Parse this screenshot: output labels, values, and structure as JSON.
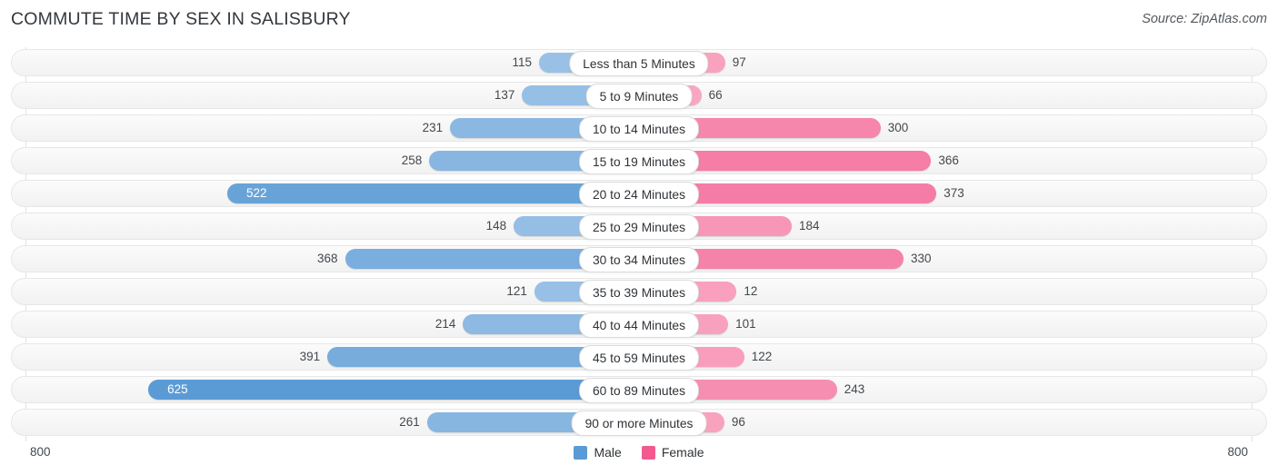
{
  "header": {
    "title": "COMMUTE TIME BY SEX IN SALISBURY",
    "source": "Source: ZipAtlas.com"
  },
  "legend": {
    "male_label": "Male",
    "female_label": "Female",
    "male_color": "#5b9bd5",
    "female_color": "#f2598f"
  },
  "axis": {
    "left_label": "800",
    "right_label": "800",
    "max": 800
  },
  "chart_data": {
    "type": "bar",
    "subtype": "diverging-horizontal-bar",
    "title": "COMMUTE TIME BY SEX IN SALISBURY",
    "xlabel": "",
    "ylabel": "",
    "xlim": [
      800,
      800
    ],
    "grid": true,
    "legend_position": "bottom-center",
    "categories": [
      "Less than 5 Minutes",
      "5 to 9 Minutes",
      "10 to 14 Minutes",
      "15 to 19 Minutes",
      "20 to 24 Minutes",
      "25 to 29 Minutes",
      "30 to 34 Minutes",
      "35 to 39 Minutes",
      "40 to 44 Minutes",
      "45 to 59 Minutes",
      "60 to 89 Minutes",
      "90 or more Minutes"
    ],
    "series": [
      {
        "name": "Male",
        "color": "#5b9bd5",
        "direction": "left",
        "values": [
          115,
          137,
          231,
          258,
          522,
          148,
          368,
          121,
          214,
          391,
          625,
          261
        ]
      },
      {
        "name": "Female",
        "color": "#f2598f",
        "direction": "right",
        "values": [
          97,
          66,
          300,
          366,
          373,
          184,
          330,
          12,
          101,
          122,
          243,
          96
        ]
      }
    ]
  },
  "rows": [
    {
      "category": "Less than 5 Minutes",
      "male": "115",
      "female": "97",
      "male_bar": 115,
      "female_bar": 97,
      "male_inside": false,
      "female_inside": false
    },
    {
      "category": "5 to 9 Minutes",
      "male": "137",
      "female": "66",
      "male_bar": 137,
      "female_bar": 66,
      "male_inside": false,
      "female_inside": false
    },
    {
      "category": "10 to 14 Minutes",
      "male": "231",
      "female": "300",
      "male_bar": 231,
      "female_bar": 300,
      "male_inside": false,
      "female_inside": false
    },
    {
      "category": "15 to 19 Minutes",
      "male": "258",
      "female": "366",
      "male_bar": 258,
      "female_bar": 366,
      "male_inside": false,
      "female_inside": false
    },
    {
      "category": "20 to 24 Minutes",
      "male": "522",
      "female": "373",
      "male_bar": 522,
      "female_bar": 373,
      "male_inside": true,
      "female_inside": false
    },
    {
      "category": "25 to 29 Minutes",
      "male": "148",
      "female": "184",
      "male_bar": 148,
      "female_bar": 184,
      "male_inside": false,
      "female_inside": false
    },
    {
      "category": "30 to 34 Minutes",
      "male": "368",
      "female": "330",
      "male_bar": 368,
      "female_bar": 330,
      "male_inside": false,
      "female_inside": false
    },
    {
      "category": "35 to 39 Minutes",
      "male": "121",
      "female": "12",
      "male_bar": 121,
      "female_bar": 112,
      "male_inside": false,
      "female_inside": false
    },
    {
      "category": "40 to 44 Minutes",
      "male": "214",
      "female": "101",
      "male_bar": 214,
      "female_bar": 101,
      "male_inside": false,
      "female_inside": false
    },
    {
      "category": "45 to 59 Minutes",
      "male": "391",
      "female": "122",
      "male_bar": 391,
      "female_bar": 122,
      "male_inside": false,
      "female_inside": false
    },
    {
      "category": "60 to 89 Minutes",
      "male": "625",
      "female": "243",
      "male_bar": 625,
      "female_bar": 243,
      "male_inside": true,
      "female_inside": false
    },
    {
      "category": "90 or more Minutes",
      "male": "261",
      "female": "96",
      "male_bar": 261,
      "female_bar": 96,
      "male_inside": false,
      "female_inside": false
    }
  ]
}
